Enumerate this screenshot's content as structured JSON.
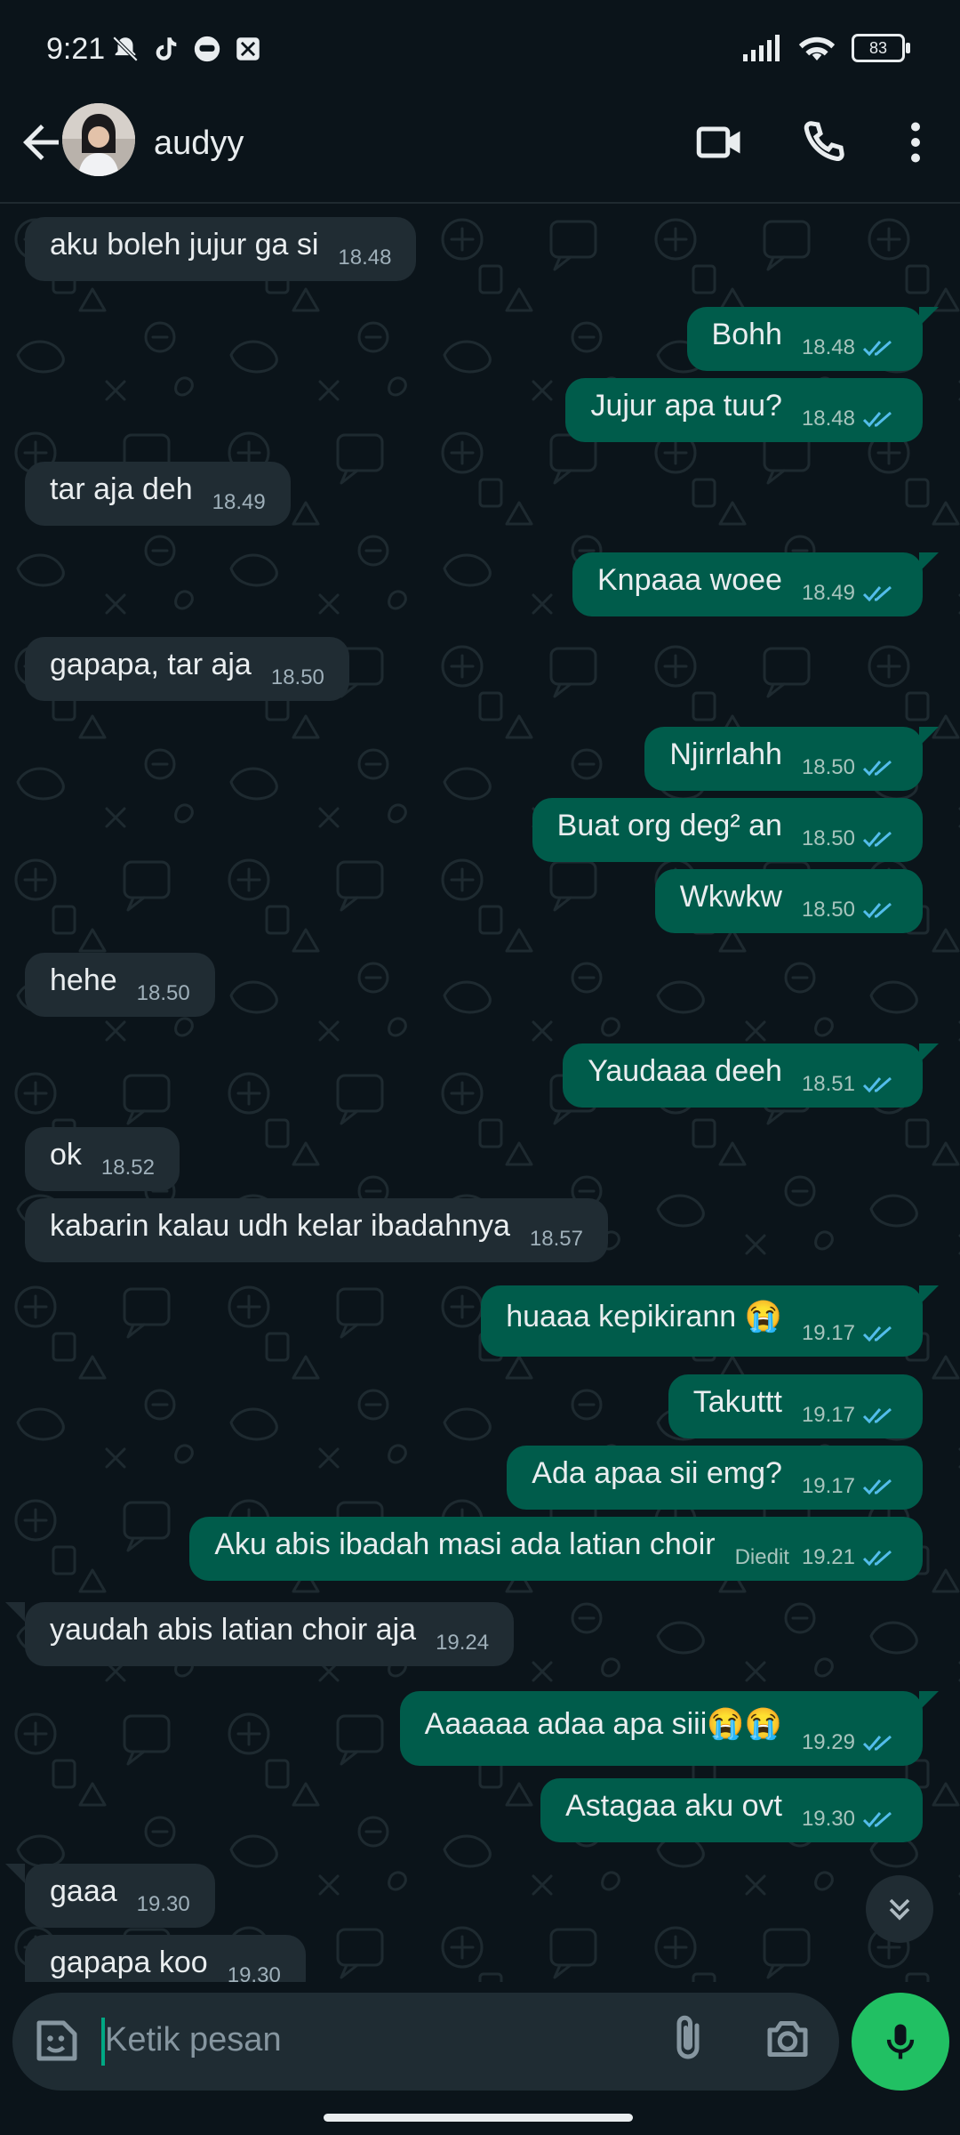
{
  "status_bar": {
    "time": "9:21",
    "battery": "83"
  },
  "header": {
    "contact_name": "audyy"
  },
  "messages": [
    {
      "dir": "in",
      "text": "aku boleh jujur ga si",
      "time": "18.48"
    },
    {
      "dir": "out",
      "text": "Bohh",
      "time": "18.48",
      "read": true
    },
    {
      "dir": "out",
      "text": "Jujur apa tuu?",
      "time": "18.48",
      "read": true
    },
    {
      "dir": "in",
      "text": "tar aja deh",
      "time": "18.49"
    },
    {
      "dir": "out",
      "text": "Knpaaa woee",
      "time": "18.49",
      "read": true
    },
    {
      "dir": "in",
      "text": "gapapa, tar aja",
      "time": "18.50"
    },
    {
      "dir": "out",
      "text": "Njirrlahh",
      "time": "18.50",
      "read": true
    },
    {
      "dir": "out",
      "text": "Buat org deg² an",
      "time": "18.50",
      "read": true
    },
    {
      "dir": "out",
      "text": "Wkwkw",
      "time": "18.50",
      "read": true
    },
    {
      "dir": "in",
      "text": "hehe",
      "time": "18.50"
    },
    {
      "dir": "out",
      "text": "Yaudaaa deeh",
      "time": "18.51",
      "read": true
    },
    {
      "dir": "in",
      "text": "ok",
      "time": "18.52"
    },
    {
      "dir": "in",
      "text": "kabarin kalau udh kelar ibadahnya",
      "time": "18.57"
    },
    {
      "dir": "out",
      "text": "huaaa kepikirann 😭",
      "time": "19.17",
      "read": true
    },
    {
      "dir": "out",
      "text": "Takuttt",
      "time": "19.17",
      "read": true
    },
    {
      "dir": "out",
      "text": "Ada apaa sii emg?",
      "time": "19.17",
      "read": true
    },
    {
      "dir": "out",
      "text": "Aku abis ibadah masi ada latian choir",
      "time": "19.21",
      "read": true,
      "edited": "Diedit"
    },
    {
      "dir": "in",
      "text": "yaudah abis latian choir aja",
      "time": "19.24"
    },
    {
      "dir": "out",
      "text": "Aaaaaa adaa apa siii😭😭",
      "time": "19.29",
      "read": true
    },
    {
      "dir": "out",
      "text": "Astagaa aku ovt",
      "time": "19.30",
      "read": true
    },
    {
      "dir": "in",
      "text": "gaaa",
      "time": "19.30"
    },
    {
      "dir": "in",
      "text": "gapapa koo",
      "time": "19.30"
    }
  ],
  "composer": {
    "placeholder": "Ketik pesan"
  },
  "colors": {
    "incoming": "#202c33",
    "outgoing": "#005c4b",
    "accent": "#21c063",
    "read_ticks": "#53bdeb"
  },
  "icons": [
    "back-arrow-icon",
    "video-call-icon",
    "voice-call-icon",
    "more-options-icon",
    "emoji-icon",
    "attach-icon",
    "camera-icon",
    "mic-icon",
    "chevron-double-down-icon"
  ]
}
